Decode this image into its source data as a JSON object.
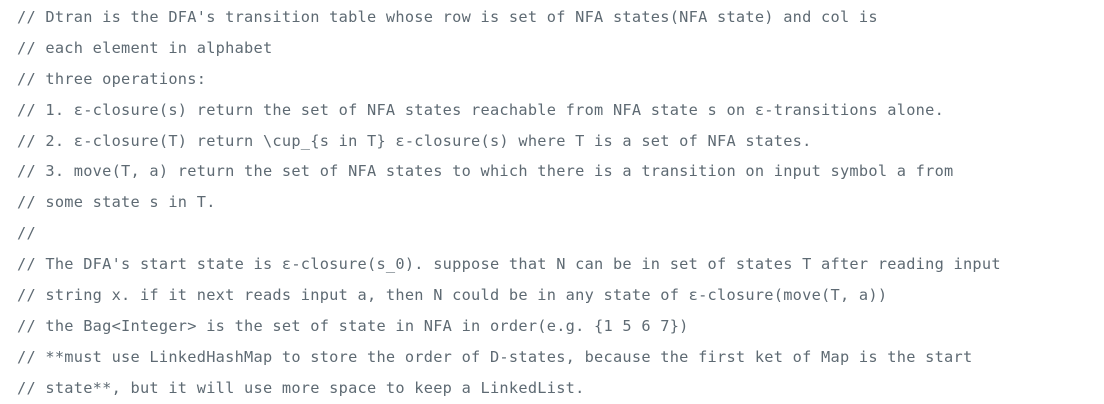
{
  "code": {
    "language_hint": "java-comment",
    "lines": [
      "// Dtran is the DFA's transition table whose row is set of NFA states(NFA state) and col is",
      "// each element in alphabet",
      "// three operations:",
      "// 1. ε-closure(s) return the set of NFA states reachable from NFA state s on ε-transitions alone.",
      "// 2. ε-closure(T) return \\cup_{s in T} ε-closure(s) where T is a set of NFA states.",
      "// 3. move(T, a) return the set of NFA states to which there is a transition on input symbol a from",
      "// some state s in T.",
      "//",
      "// The DFA's start state is ε-closure(s_0). suppose that N can be in set of states T after reading input",
      "// string x. if it next reads input a, then N could be in any state of ε-closure(move(T, a))",
      "// the Bag<Integer> is the set of state in NFA in order(e.g. {1 5 6 7})",
      "// **must use LinkedHashMap to store the order of D-states, because the first ket of Map is the start",
      "// state**, but it will use more space to keep a LinkedList."
    ]
  },
  "colors": {
    "background": "#ffffff",
    "comment_text": "#5e6a73"
  }
}
